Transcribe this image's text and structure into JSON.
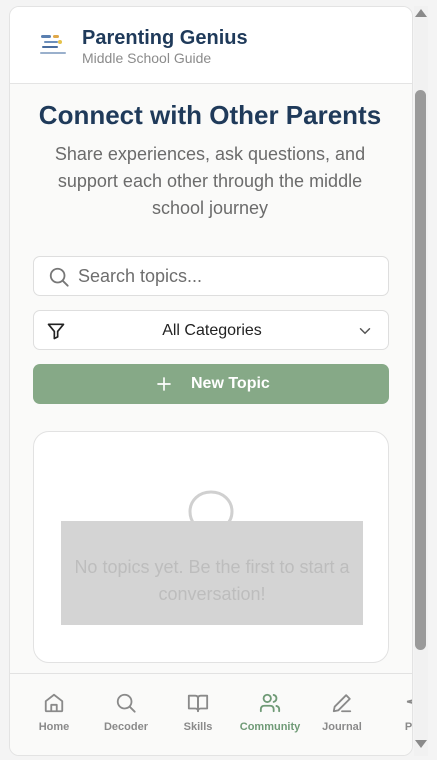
{
  "header": {
    "logo_icon": "parenting-genius-logo",
    "title": "Parenting Genius",
    "subtitle": "Middle School Guide"
  },
  "main": {
    "title": "Connect with Other Parents",
    "description": "Share experiences, ask questions, and support each other through the middle school journey",
    "search": {
      "placeholder": "Search topics...",
      "value": ""
    },
    "category_filter": {
      "selected": "All Categories"
    },
    "new_topic_label": "New Topic",
    "empty_state": "No topics yet. Be the first to start a conversation!"
  },
  "nav": {
    "items": [
      {
        "label": "Home",
        "icon": "home-icon"
      },
      {
        "label": "Decoder",
        "icon": "search-icon"
      },
      {
        "label": "Skills",
        "icon": "book-icon"
      },
      {
        "label": "Community",
        "icon": "users-icon",
        "active": true
      },
      {
        "label": "Journal",
        "icon": "pencil-icon"
      },
      {
        "label": "Pro",
        "icon": "sparkle-icon"
      }
    ]
  },
  "colors": {
    "brand_navy": "#1f3a5a",
    "accent_green": "#86a987",
    "active_nav": "#6f9a76"
  }
}
